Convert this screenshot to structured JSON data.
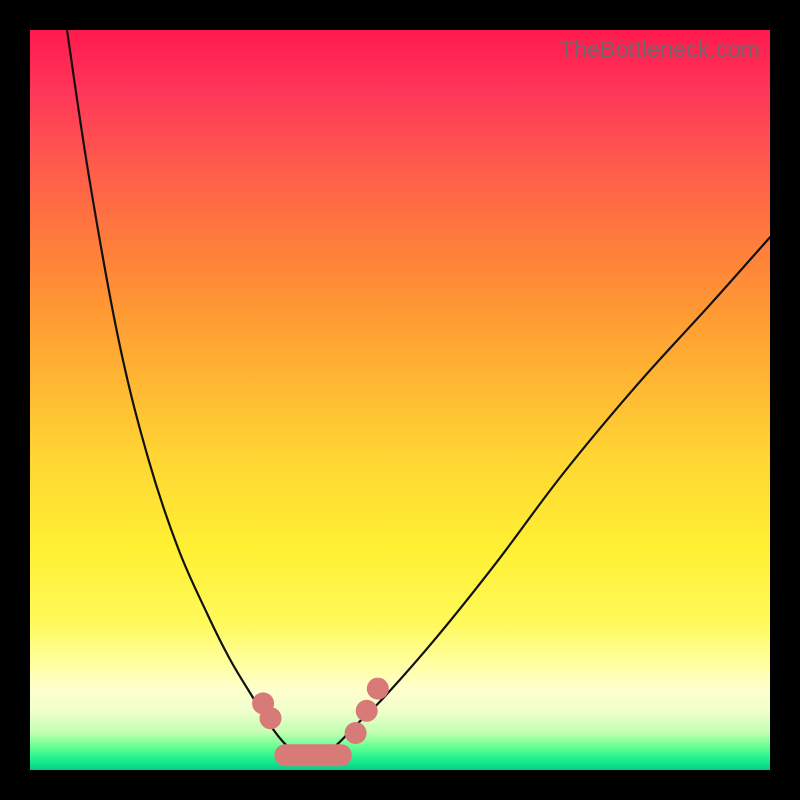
{
  "watermark": "TheBottleneck.com",
  "colors": {
    "background": "#000000",
    "gradient_top": "#ff1a4d",
    "gradient_mid": "#ffd633",
    "gradient_bottom": "#00d088",
    "curve": "#111111",
    "marker": "#d87a78"
  },
  "chart_data": {
    "type": "line",
    "title": "",
    "xlabel": "",
    "ylabel": "",
    "xlim": [
      0,
      100
    ],
    "ylim": [
      0,
      100
    ],
    "grid": false,
    "legend": false,
    "note": "Bottleneck-style V curve. Minimum (best, green zone) around x≈38. Curve rises sharply to both sides. Salmon markers highlight points near the bottom of the V on both branches plus a flat segment at the trough. Y is read as distance from bottom (green) to top (red); values are visual estimates.",
    "series": [
      {
        "name": "left-branch",
        "x": [
          5,
          8,
          12,
          16,
          20,
          24,
          27,
          30,
          32.5,
          35,
          38
        ],
        "y": [
          100,
          80,
          58,
          42,
          30,
          21,
          15,
          10,
          6,
          3,
          1
        ]
      },
      {
        "name": "right-branch",
        "x": [
          38,
          41,
          44,
          48,
          55,
          63,
          72,
          82,
          92,
          100
        ],
        "y": [
          1,
          3,
          6,
          10,
          18,
          28,
          40,
          52,
          63,
          72
        ]
      }
    ],
    "markers": [
      {
        "kind": "dot",
        "x": 31.5,
        "y": 9
      },
      {
        "kind": "dot",
        "x": 32.5,
        "y": 7
      },
      {
        "kind": "pill",
        "x0": 34.5,
        "y0": 2,
        "x1": 42,
        "y1": 2
      },
      {
        "kind": "dot",
        "x": 44,
        "y": 5
      },
      {
        "kind": "dot",
        "x": 45.5,
        "y": 8
      },
      {
        "kind": "dot",
        "x": 47,
        "y": 11
      }
    ]
  }
}
